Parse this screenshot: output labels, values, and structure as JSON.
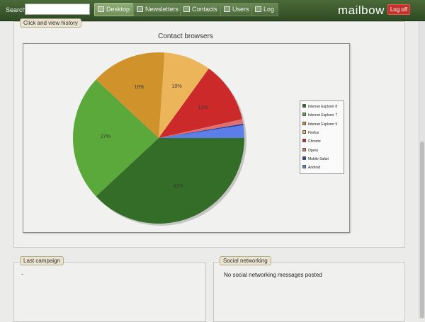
{
  "toolbar": {
    "search_label": "Search",
    "search_value": "",
    "nav": [
      {
        "label": "Desktop",
        "icon": "desktop-icon"
      },
      {
        "label": "Newsletters",
        "icon": "newsletter-icon"
      },
      {
        "label": "Contacts",
        "icon": "contacts-icon"
      },
      {
        "label": "Users",
        "icon": "users-icon"
      },
      {
        "label": "Log",
        "icon": "log-icon"
      }
    ],
    "logo": "mailbow",
    "logoff_label": "Log off"
  },
  "history_panel": {
    "legend": "Click and view history"
  },
  "chart_data": {
    "type": "pie",
    "title": "Contact browsers",
    "slices": [
      {
        "label": "Internet Explorer 8",
        "value": 43,
        "color": "#336d27",
        "data_label": "43%"
      },
      {
        "label": "Internet Explorer 7",
        "value": 27,
        "color": "#5ba83b",
        "data_label": "27%"
      },
      {
        "label": "Internet Explorer 9",
        "value": 16,
        "color": "#d0922a",
        "data_label": "16%"
      },
      {
        "label": "Firefox",
        "value": 10,
        "color": "#edb55a",
        "data_label": "10%"
      },
      {
        "label": "Chrome",
        "value": 13,
        "color": "#cc2a2a",
        "data_label": "13%"
      },
      {
        "label": "Opera",
        "value": 1,
        "color": "#e07070",
        "data_label": ""
      },
      {
        "label": "Mobile Safari",
        "value": 0.3,
        "color": "#2a3f9e",
        "data_label": ""
      },
      {
        "label": "Android",
        "value": 2.7,
        "color": "#5c7ee8",
        "data_label": ""
      }
    ],
    "legend_position": "right"
  },
  "last_campaign": {
    "legend": "Last campaign",
    "content": "-"
  },
  "social": {
    "legend": "Social networking",
    "message": "No social networking messages posted"
  }
}
